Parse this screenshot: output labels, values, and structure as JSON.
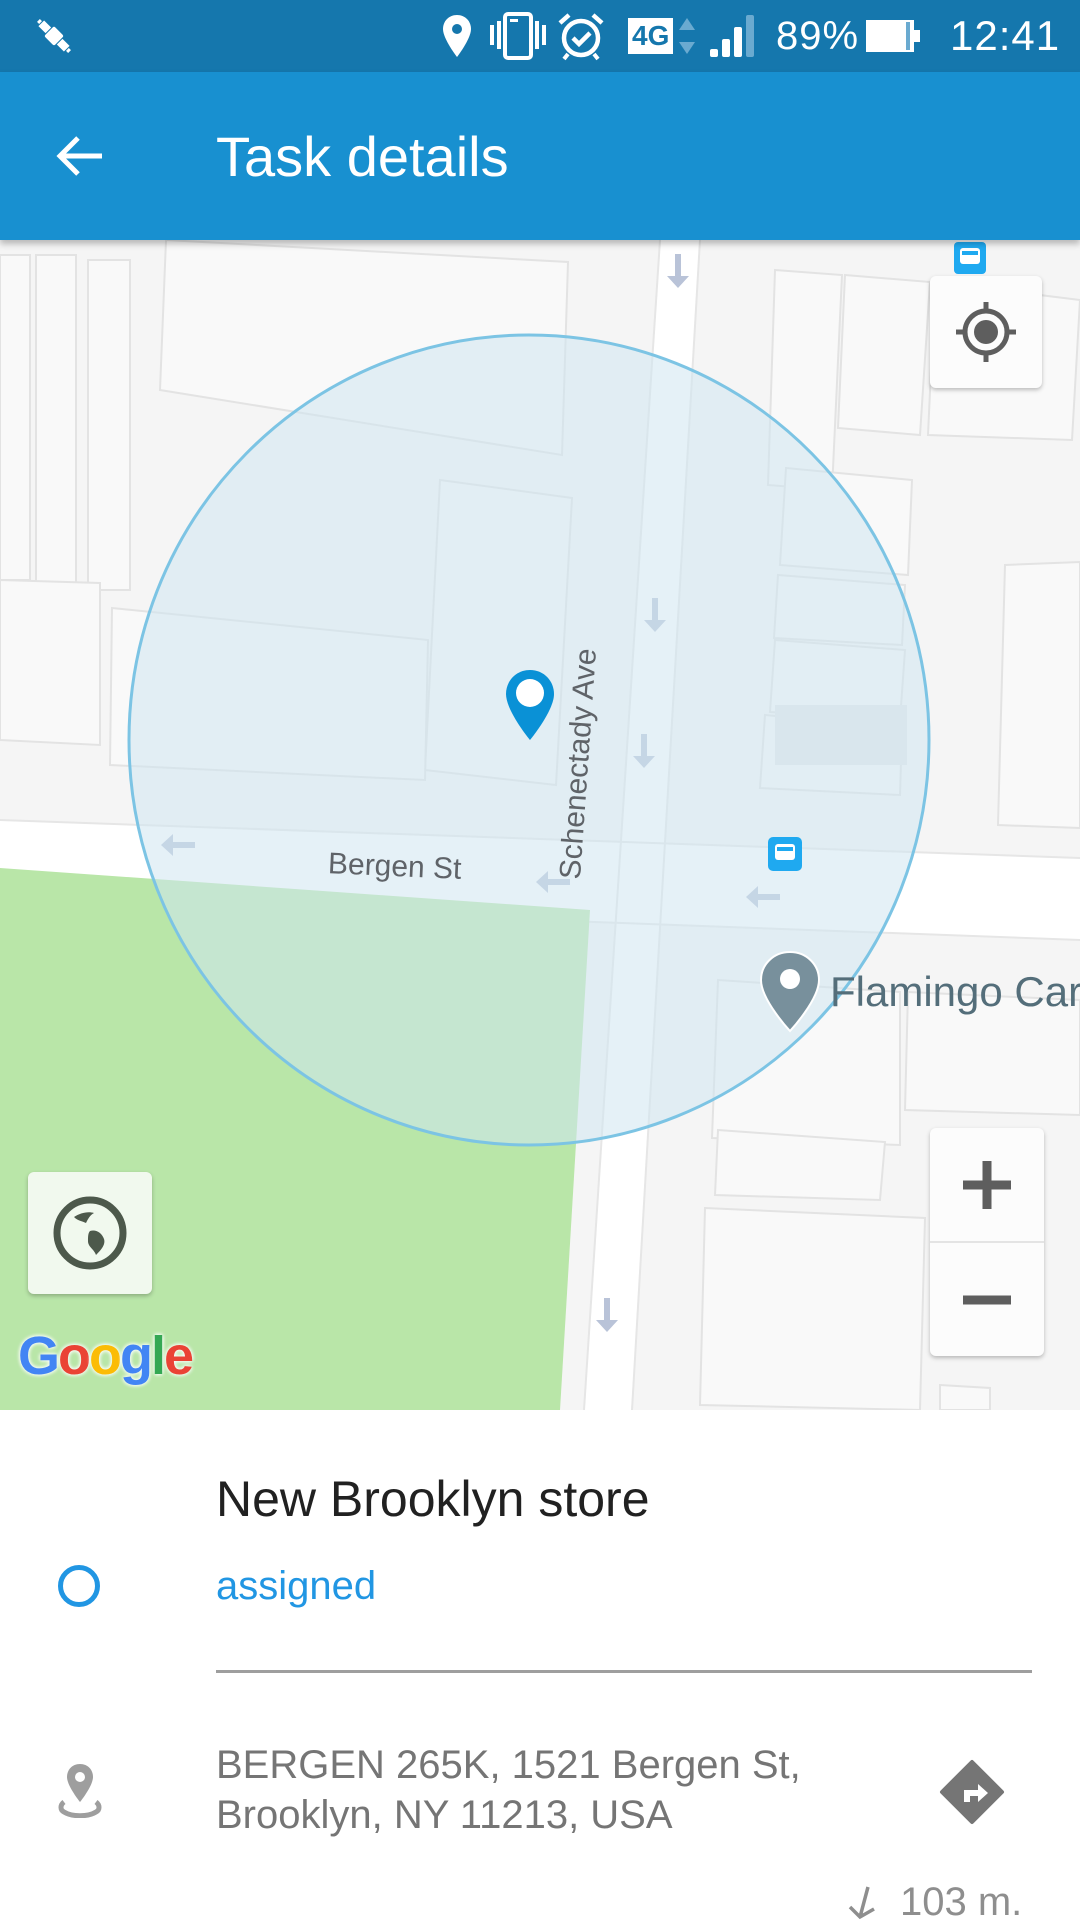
{
  "status_bar": {
    "icons": [
      "satellite-icon",
      "location-icon",
      "vibrate-icon",
      "alarm-icon",
      "network-4g-icon",
      "signal-icon",
      "battery-icon"
    ],
    "network": "4G",
    "battery": "89%",
    "time": "12:41"
  },
  "app_bar": {
    "title": "Task details",
    "back_icon": "arrow-left-icon"
  },
  "map": {
    "streets": [
      "Bergen St",
      "Schenectady Ave"
    ],
    "poi": "Flamingo Car",
    "attribution": "Google",
    "controls": {
      "my_location": "my-location-icon",
      "map_type": "globe-icon",
      "zoom_in": "+",
      "zoom_out": "−"
    },
    "colors": {
      "geofence_fill": "#d3e9f3",
      "geofence_stroke": "#7cc4e4",
      "marker": "#0a91d6",
      "park": "#b7e4a7",
      "transit": "#1fa9f0"
    }
  },
  "task": {
    "name": "New Brooklyn store",
    "status": "assigned",
    "status_color": "#2196e3",
    "address_line1": "BERGEN 265K, 1521 Bergen St,",
    "address_line2": "Brooklyn, NY 11213, USA",
    "distance": "103 m."
  }
}
